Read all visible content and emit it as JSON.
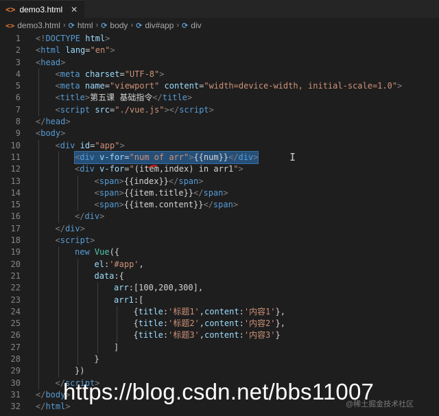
{
  "tab": {
    "icon": "html-file-icon",
    "name": "demo3.html",
    "close": "✕"
  },
  "breadcrumb": {
    "items": [
      "demo3.html",
      "html",
      "body",
      "div#app",
      "div"
    ]
  },
  "code_lines": [
    {
      "n": "1",
      "indent": 1,
      "tokens": [
        [
          "p",
          "<!"
        ],
        [
          "t",
          "DOCTYPE"
        ],
        [
          "x",
          " "
        ],
        [
          "a",
          "html"
        ],
        [
          "p",
          ">"
        ]
      ]
    },
    {
      "n": "2",
      "indent": 1,
      "tokens": [
        [
          "p",
          "<"
        ],
        [
          "t",
          "html"
        ],
        [
          "x",
          " "
        ],
        [
          "a",
          "lang"
        ],
        [
          "x",
          "="
        ],
        [
          "s",
          "\"en\""
        ],
        [
          "p",
          ">"
        ]
      ]
    },
    {
      "n": "3",
      "indent": 1,
      "tokens": [
        [
          "p",
          "<"
        ],
        [
          "t",
          "head"
        ],
        [
          "p",
          ">"
        ]
      ]
    },
    {
      "n": "4",
      "indent": 2,
      "tokens": [
        [
          "p",
          "<"
        ],
        [
          "t",
          "meta"
        ],
        [
          "x",
          " "
        ],
        [
          "a",
          "charset"
        ],
        [
          "x",
          "="
        ],
        [
          "s",
          "\"UTF-8\""
        ],
        [
          "p",
          ">"
        ]
      ]
    },
    {
      "n": "5",
      "indent": 2,
      "tokens": [
        [
          "p",
          "<"
        ],
        [
          "t",
          "meta"
        ],
        [
          "x",
          " "
        ],
        [
          "a",
          "name"
        ],
        [
          "x",
          "="
        ],
        [
          "s",
          "\"viewport\""
        ],
        [
          "x",
          " "
        ],
        [
          "a",
          "content"
        ],
        [
          "x",
          "="
        ],
        [
          "s",
          "\"width=device-width, initial-scale=1.0\""
        ],
        [
          "p",
          ">"
        ]
      ]
    },
    {
      "n": "6",
      "indent": 2,
      "tokens": [
        [
          "p",
          "<"
        ],
        [
          "t",
          "title"
        ],
        [
          "p",
          ">"
        ],
        [
          "x",
          "第五课 基础指令"
        ],
        [
          "p",
          "</"
        ],
        [
          "t",
          "title"
        ],
        [
          "p",
          ">"
        ]
      ]
    },
    {
      "n": "7",
      "indent": 2,
      "tokens": [
        [
          "p",
          "<"
        ],
        [
          "t",
          "script"
        ],
        [
          "x",
          " "
        ],
        [
          "a",
          "src"
        ],
        [
          "x",
          "="
        ],
        [
          "s",
          "\"./vue.js\""
        ],
        [
          "p",
          ">"
        ],
        [
          "p",
          "</"
        ],
        [
          "t",
          "script"
        ],
        [
          "p",
          ">"
        ]
      ]
    },
    {
      "n": "8",
      "indent": 1,
      "tokens": [
        [
          "p",
          "</"
        ],
        [
          "t",
          "head"
        ],
        [
          "p",
          ">"
        ]
      ]
    },
    {
      "n": "9",
      "indent": 1,
      "tokens": [
        [
          "p",
          "<"
        ],
        [
          "t",
          "body"
        ],
        [
          "p",
          ">"
        ]
      ]
    },
    {
      "n": "10",
      "indent": 2,
      "tokens": [
        [
          "p",
          "<"
        ],
        [
          "t",
          "div"
        ],
        [
          "x",
          " "
        ],
        [
          "a",
          "id"
        ],
        [
          "x",
          "="
        ],
        [
          "s",
          "\"app\""
        ],
        [
          "p",
          ">"
        ]
      ]
    },
    {
      "n": "11",
      "indent": 3,
      "selected": true,
      "tokens": [
        [
          "p",
          "<"
        ],
        [
          "t",
          "div"
        ],
        [
          "x",
          " "
        ],
        [
          "a",
          "v-for"
        ],
        [
          "x",
          "="
        ],
        [
          "s",
          "\"num of arr\""
        ],
        [
          "p",
          ">"
        ],
        [
          "x",
          "{{num}}"
        ],
        [
          "p",
          "</"
        ],
        [
          "t",
          "div"
        ],
        [
          "p",
          ">"
        ]
      ]
    },
    {
      "n": "12",
      "indent": 3,
      "tokens": [
        [
          "p",
          "<"
        ],
        [
          "t",
          "div"
        ],
        [
          "x",
          " "
        ],
        [
          "a",
          "v-for"
        ],
        [
          "x",
          "="
        ],
        [
          "s",
          "\""
        ],
        [
          "x",
          "(item,index) in arr1"
        ],
        [
          "s",
          "\""
        ],
        [
          "p",
          ">"
        ]
      ]
    },
    {
      "n": "13",
      "indent": 4,
      "tokens": [
        [
          "p",
          "<"
        ],
        [
          "t",
          "span"
        ],
        [
          "p",
          ">"
        ],
        [
          "x",
          "{{index}}"
        ],
        [
          "p",
          "</"
        ],
        [
          "t",
          "span"
        ],
        [
          "p",
          ">"
        ]
      ]
    },
    {
      "n": "14",
      "indent": 4,
      "tokens": [
        [
          "p",
          "<"
        ],
        [
          "t",
          "span"
        ],
        [
          "p",
          ">"
        ],
        [
          "x",
          "{{item.title}}"
        ],
        [
          "p",
          "</"
        ],
        [
          "t",
          "span"
        ],
        [
          "p",
          ">"
        ]
      ]
    },
    {
      "n": "15",
      "indent": 4,
      "tokens": [
        [
          "p",
          "<"
        ],
        [
          "t",
          "span"
        ],
        [
          "p",
          ">"
        ],
        [
          "x",
          "{{item.content}}"
        ],
        [
          "p",
          "</"
        ],
        [
          "t",
          "span"
        ],
        [
          "p",
          ">"
        ]
      ]
    },
    {
      "n": "16",
      "indent": 3,
      "tokens": [
        [
          "p",
          "</"
        ],
        [
          "t",
          "div"
        ],
        [
          "p",
          ">"
        ]
      ]
    },
    {
      "n": "17",
      "indent": 2,
      "tokens": [
        [
          "p",
          "</"
        ],
        [
          "t",
          "div"
        ],
        [
          "p",
          ">"
        ]
      ]
    },
    {
      "n": "18",
      "indent": 2,
      "tokens": [
        [
          "p",
          "<"
        ],
        [
          "t",
          "script"
        ],
        [
          "p",
          ">"
        ]
      ]
    },
    {
      "n": "19",
      "indent": 3,
      "tokens": [
        [
          "t",
          "new"
        ],
        [
          "x",
          " "
        ],
        [
          "k",
          "Vue"
        ],
        [
          "x",
          "({"
        ]
      ]
    },
    {
      "n": "20",
      "indent": 4,
      "tokens": [
        [
          "a",
          "el"
        ],
        [
          "x",
          ":"
        ],
        [
          "s",
          "'#app'"
        ],
        [
          "x",
          ","
        ]
      ]
    },
    {
      "n": "21",
      "indent": 4,
      "tokens": [
        [
          "a",
          "data"
        ],
        [
          "x",
          ":{"
        ]
      ]
    },
    {
      "n": "22",
      "indent": 5,
      "tokens": [
        [
          "a",
          "arr"
        ],
        [
          "x",
          ":[100,200,300],"
        ]
      ]
    },
    {
      "n": "23",
      "indent": 5,
      "tokens": [
        [
          "a",
          "arr1"
        ],
        [
          "x",
          ":["
        ]
      ]
    },
    {
      "n": "24",
      "indent": 6,
      "tokens": [
        [
          "x",
          "{"
        ],
        [
          "a",
          "title"
        ],
        [
          "x",
          ":"
        ],
        [
          "s",
          "'标题1'"
        ],
        [
          "x",
          ","
        ],
        [
          "a",
          "content"
        ],
        [
          "x",
          ":"
        ],
        [
          "s",
          "'内容1'"
        ],
        [
          "x",
          "},"
        ]
      ]
    },
    {
      "n": "25",
      "indent": 6,
      "tokens": [
        [
          "x",
          "{"
        ],
        [
          "a",
          "title"
        ],
        [
          "x",
          ":"
        ],
        [
          "s",
          "'标题2'"
        ],
        [
          "x",
          ","
        ],
        [
          "a",
          "content"
        ],
        [
          "x",
          ":"
        ],
        [
          "s",
          "'内容2'"
        ],
        [
          "x",
          "},"
        ]
      ]
    },
    {
      "n": "26",
      "indent": 6,
      "tokens": [
        [
          "x",
          "{"
        ],
        [
          "a",
          "title"
        ],
        [
          "x",
          ":"
        ],
        [
          "s",
          "'标题3'"
        ],
        [
          "x",
          ","
        ],
        [
          "a",
          "content"
        ],
        [
          "x",
          ":"
        ],
        [
          "s",
          "'内容3'"
        ],
        [
          "x",
          "}"
        ]
      ]
    },
    {
      "n": "27",
      "indent": 5,
      "tokens": [
        [
          "x",
          "]"
        ]
      ]
    },
    {
      "n": "28",
      "indent": 4,
      "tokens": [
        [
          "x",
          "}"
        ]
      ]
    },
    {
      "n": "29",
      "indent": 3,
      "tokens": [
        [
          "x",
          "})"
        ]
      ]
    },
    {
      "n": "30",
      "indent": 2,
      "tokens": [
        [
          "p",
          "</"
        ],
        [
          "t",
          "script"
        ],
        [
          "p",
          ">"
        ]
      ]
    },
    {
      "n": "31",
      "indent": 1,
      "tokens": [
        [
          "p",
          "</"
        ],
        [
          "t",
          "body"
        ],
        [
          "p",
          ">"
        ]
      ]
    },
    {
      "n": "32",
      "indent": 1,
      "tokens": [
        [
          "p",
          "</"
        ],
        [
          "t",
          "html"
        ],
        [
          "p",
          ">"
        ]
      ]
    }
  ],
  "overlay": {
    "watermark": "https://blog.csdn.net/bbs11007",
    "watermark_small": "@稀土掘金技术社区"
  },
  "colors": {
    "editor_bg": "#1e1e1e",
    "tag": "#569cd6",
    "attribute": "#9cdcfe",
    "string": "#ce9178",
    "selection": "#264f78"
  }
}
